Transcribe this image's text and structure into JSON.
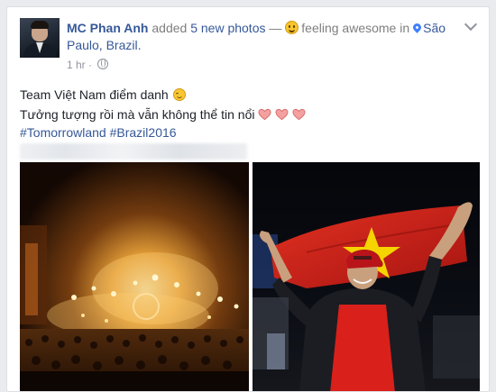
{
  "post": {
    "author": "MC Phan Anh",
    "action": "added",
    "photo_count_text": "5 new photos",
    "separator": "—",
    "feeling": "feeling awesome",
    "in_word": "in",
    "location": "São Paulo, Brazil.",
    "time": "1 hr",
    "dot": "·",
    "text_line1": "Team Việt Nam điểm danh",
    "text_line2": "Tưởng tượng rồi mà vẫn không thể tin nổi",
    "hashtags": [
      "#Tomorrowland",
      "#Brazil2016"
    ]
  },
  "icons": {
    "feeling": "smiling-face-icon",
    "location": "location-pin-icon",
    "privacy": "globe-icon",
    "menu": "chevron-down-icon",
    "emoji_smile": "smiley-emoji",
    "emoji_heart": "heart-emoji"
  },
  "colors": {
    "link": "#365899",
    "muted": "#90949c",
    "text": "#1d2129",
    "heart": "#f28b8b",
    "flag_red": "#d52b1e",
    "flag_star": "#f5d400"
  }
}
